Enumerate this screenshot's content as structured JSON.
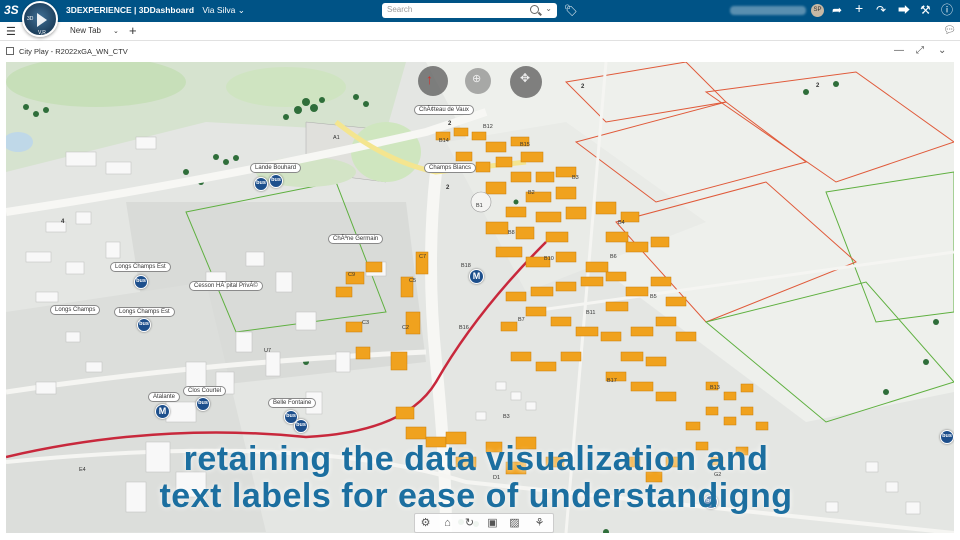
{
  "topbar": {
    "ds_logo": "3S",
    "brand_bold": "3DEXPERIENCE | 3DDashboard",
    "space_name": "Via Silva",
    "search_placeholder": "Search",
    "avatar_initials": "SP"
  },
  "tabbar": {
    "tab_label": "New Tab"
  },
  "widget": {
    "title": "City Play - R2022xGA_WN_CTV"
  },
  "map": {
    "place_labels": [
      "ChÃ¢teau de Vaux",
      "Champs Blancs",
      "Lande Bouhard",
      "ChÃªne Germain",
      "Longs Champs Est",
      "Cesson HÃ´pital PrivÃ©",
      "Longs Champs",
      "Longs Champs Est",
      "Clos Courtel",
      "Atalante",
      "Belle Fontaine"
    ],
    "bus_stop_label": "bus",
    "metro_label": "M",
    "block_ids": [
      "A1",
      "B12",
      "B14",
      "B15",
      "B2",
      "B3",
      "B6",
      "B7",
      "B8",
      "B1",
      "B10",
      "B4",
      "B5",
      "B16",
      "B11",
      "B14",
      "B17",
      "B13",
      "C7",
      "C5",
      "C3",
      "C2",
      "C9",
      "B18",
      "U7",
      "B3",
      "E4",
      "D1",
      "G2"
    ],
    "road_numbers": [
      "2",
      "2",
      "4",
      "2",
      "2"
    ]
  },
  "caption": {
    "line1": "retaining the data visualization and",
    "line2": "text labels for ease of understandigng"
  },
  "colors": {
    "topbar": "#005386",
    "building_highlight": "#f0a21e",
    "caption_text": "#1c6fa0",
    "transit_pin": "#1d4f8c",
    "rail_line": "#c8283c"
  }
}
